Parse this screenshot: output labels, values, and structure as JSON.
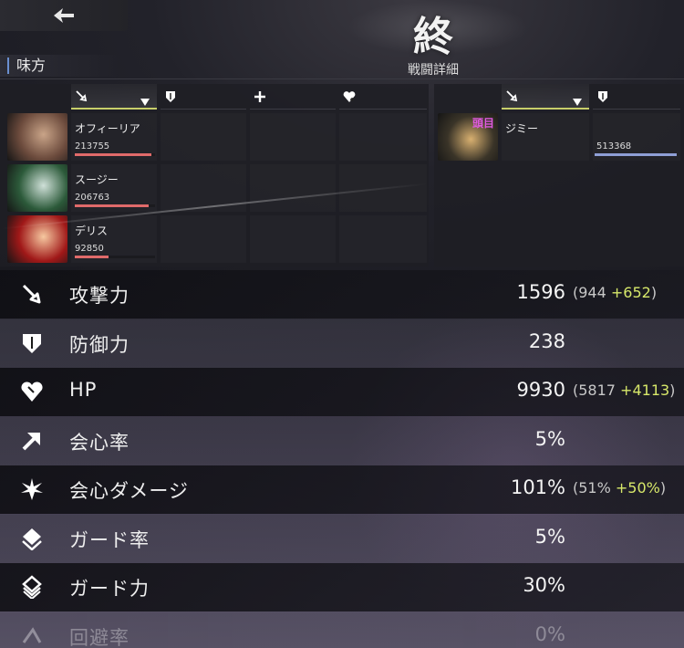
{
  "header": {
    "end_mark": "終",
    "side_label": "味方",
    "panel_title": "戦闘詳細"
  },
  "allies": [
    {
      "name": "オフィーリア",
      "value": "213755",
      "bar_ratio": 0.95,
      "bar_color": "#e06a6a",
      "avatar_colors": [
        "#6b4a3c",
        "#c9a488"
      ]
    },
    {
      "name": "スージー",
      "value": "206763",
      "bar_ratio": 0.92,
      "bar_color": "#e06a6a",
      "avatar_colors": [
        "#2c5a3a",
        "#cfe0d8"
      ]
    },
    {
      "name": "デリス",
      "value": "92850",
      "bar_ratio": 0.42,
      "bar_color": "#e06a6a",
      "avatar_colors": [
        "#a01818",
        "#f6c8a0"
      ]
    }
  ],
  "enemies": [
    {
      "name": "ジミー",
      "tag": "頭目",
      "value": "513368",
      "bar_ratio": 1.0,
      "bar_color": "#8f9fd6",
      "avatar_colors": [
        "#3a3428",
        "#d8b070"
      ]
    }
  ],
  "stats": [
    {
      "label": "攻撃力",
      "value": "1596",
      "base": "(944 ",
      "bonus": "+652",
      "close": ")",
      "icon": "sword-icon"
    },
    {
      "label": "防御力",
      "value": "238",
      "base": "",
      "bonus": "",
      "close": "",
      "icon": "shield-icon"
    },
    {
      "label": "HP",
      "value": "9930",
      "base": "(5817 ",
      "bonus": "+4113",
      "close": ")",
      "icon": "heart-icon"
    },
    {
      "label": "会心率",
      "value": "5%",
      "base": "",
      "bonus": "",
      "close": "",
      "icon": "crit-arrow-icon"
    },
    {
      "label": "会心ダメージ",
      "value": "101%",
      "base": "(51% ",
      "bonus": "+50%",
      "close": ")",
      "icon": "burst-icon"
    },
    {
      "label": "ガード率",
      "value": "5%",
      "base": "",
      "bonus": "",
      "close": "",
      "icon": "guard-diamond-icon"
    },
    {
      "label": "ガード力",
      "value": "30%",
      "base": "",
      "bonus": "",
      "close": "",
      "icon": "guard-layers-icon"
    },
    {
      "label": "回避率",
      "value": "0%",
      "base": "",
      "bonus": "",
      "close": "",
      "icon": "evade-icon"
    }
  ],
  "colors": {
    "accent": "#c8cf6a",
    "bonus": "#d7e86a",
    "ally_bar": "#e06a6a",
    "enemy_bar": "#8f9fd6",
    "boss_tag": "#e05ae0"
  }
}
